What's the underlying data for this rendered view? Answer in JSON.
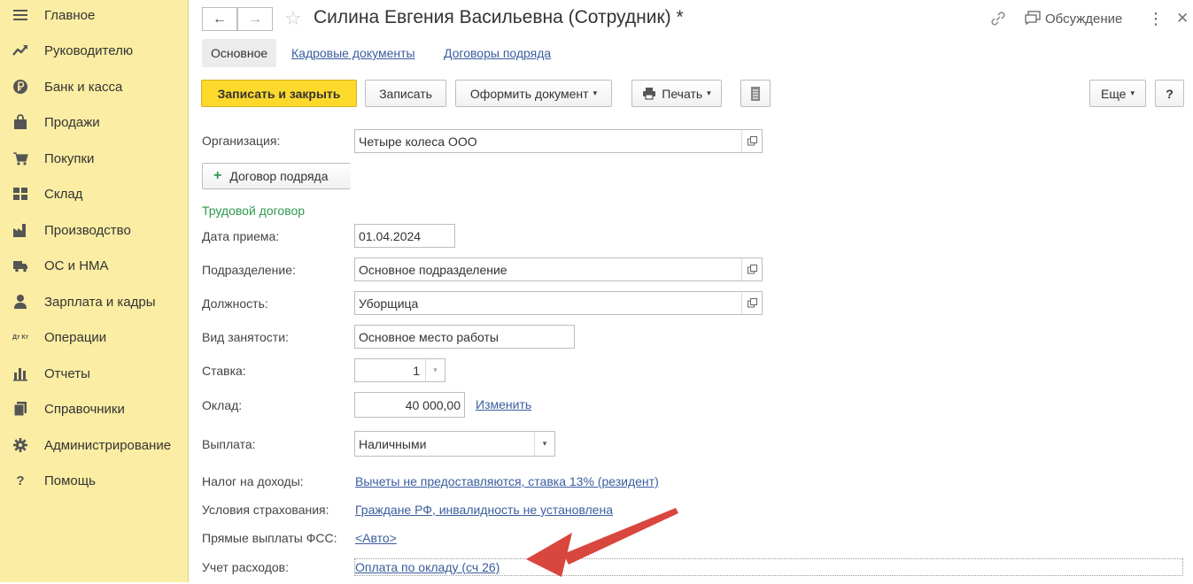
{
  "sidebar": {
    "items": [
      {
        "label": "Главное",
        "icon": "menu-icon"
      },
      {
        "label": "Руководителю",
        "icon": "trend-icon"
      },
      {
        "label": "Банк и касса",
        "icon": "ruble-icon"
      },
      {
        "label": "Продажи",
        "icon": "bag-icon"
      },
      {
        "label": "Покупки",
        "icon": "cart-icon"
      },
      {
        "label": "Склад",
        "icon": "warehouse-icon"
      },
      {
        "label": "Производство",
        "icon": "factory-icon"
      },
      {
        "label": "ОС и НМА",
        "icon": "truck-icon"
      },
      {
        "label": "Зарплата и кадры",
        "icon": "person-icon"
      },
      {
        "label": "Операции",
        "icon": "dtkt-icon"
      },
      {
        "label": "Отчеты",
        "icon": "bar-chart-icon"
      },
      {
        "label": "Справочники",
        "icon": "books-icon"
      },
      {
        "label": "Администрирование",
        "icon": "gear-icon"
      },
      {
        "label": "Помощь",
        "icon": "question-icon"
      }
    ],
    "dtkt_glyph": "Дт Кт",
    "help_glyph": "?"
  },
  "header": {
    "back": "←",
    "forward": "→",
    "star": "☆",
    "title": "Силина Евгения Васильевна (Сотрудник) *",
    "discussion": "Обсуждение",
    "more": "⋮",
    "close": "✕"
  },
  "tabs": [
    {
      "label": "Основное",
      "active": true
    },
    {
      "label": "Кадровые документы",
      "active": false
    },
    {
      "label": "Договоры подряда",
      "active": false
    }
  ],
  "toolbar": {
    "save_close": "Записать и закрыть",
    "save": "Записать",
    "create_doc": "Оформить документ",
    "print": "Печать",
    "more": "Еще",
    "help": "?",
    "dropdown_arrow": "▾"
  },
  "form": {
    "org_label": "Организация:",
    "org_value": "Четыре колеса ООО",
    "contract_btn": "Договор подряда",
    "contract_plus": "+",
    "section_title": "Трудовой договор",
    "hire_date_label": "Дата приема:",
    "hire_date_value": "01.04.2024",
    "dept_label": "Подразделение:",
    "dept_value": "Основное подразделение",
    "position_label": "Должность:",
    "position_value": "Уборщица",
    "employment_label": "Вид занятости:",
    "employment_value": "Основное место работы",
    "rate_label": "Ставка:",
    "rate_value": "1",
    "salary_label": "Оклад:",
    "salary_value": "40 000,00",
    "salary_change": "Изменить",
    "payment_label": "Выплата:",
    "payment_value": "Наличными",
    "tax_label": "Налог на доходы:",
    "tax_value": "Вычеты не предоставляются, ставка 13% (резидент)",
    "insurance_label": "Условия страхования:",
    "insurance_value": "Граждане РФ, инвалидность не установлена",
    "fss_label": "Прямые выплаты ФСС:",
    "fss_value": "<Авто>",
    "expense_label": "Учет расходов:",
    "expense_value": "Оплата по окладу (сч 26)"
  },
  "colors": {
    "sidebar_bg": "#fbeda3",
    "primary_button": "#fdd92c",
    "link": "#3a5d9e",
    "section_green": "#2e9a4e",
    "arrow": "#d9463e"
  }
}
